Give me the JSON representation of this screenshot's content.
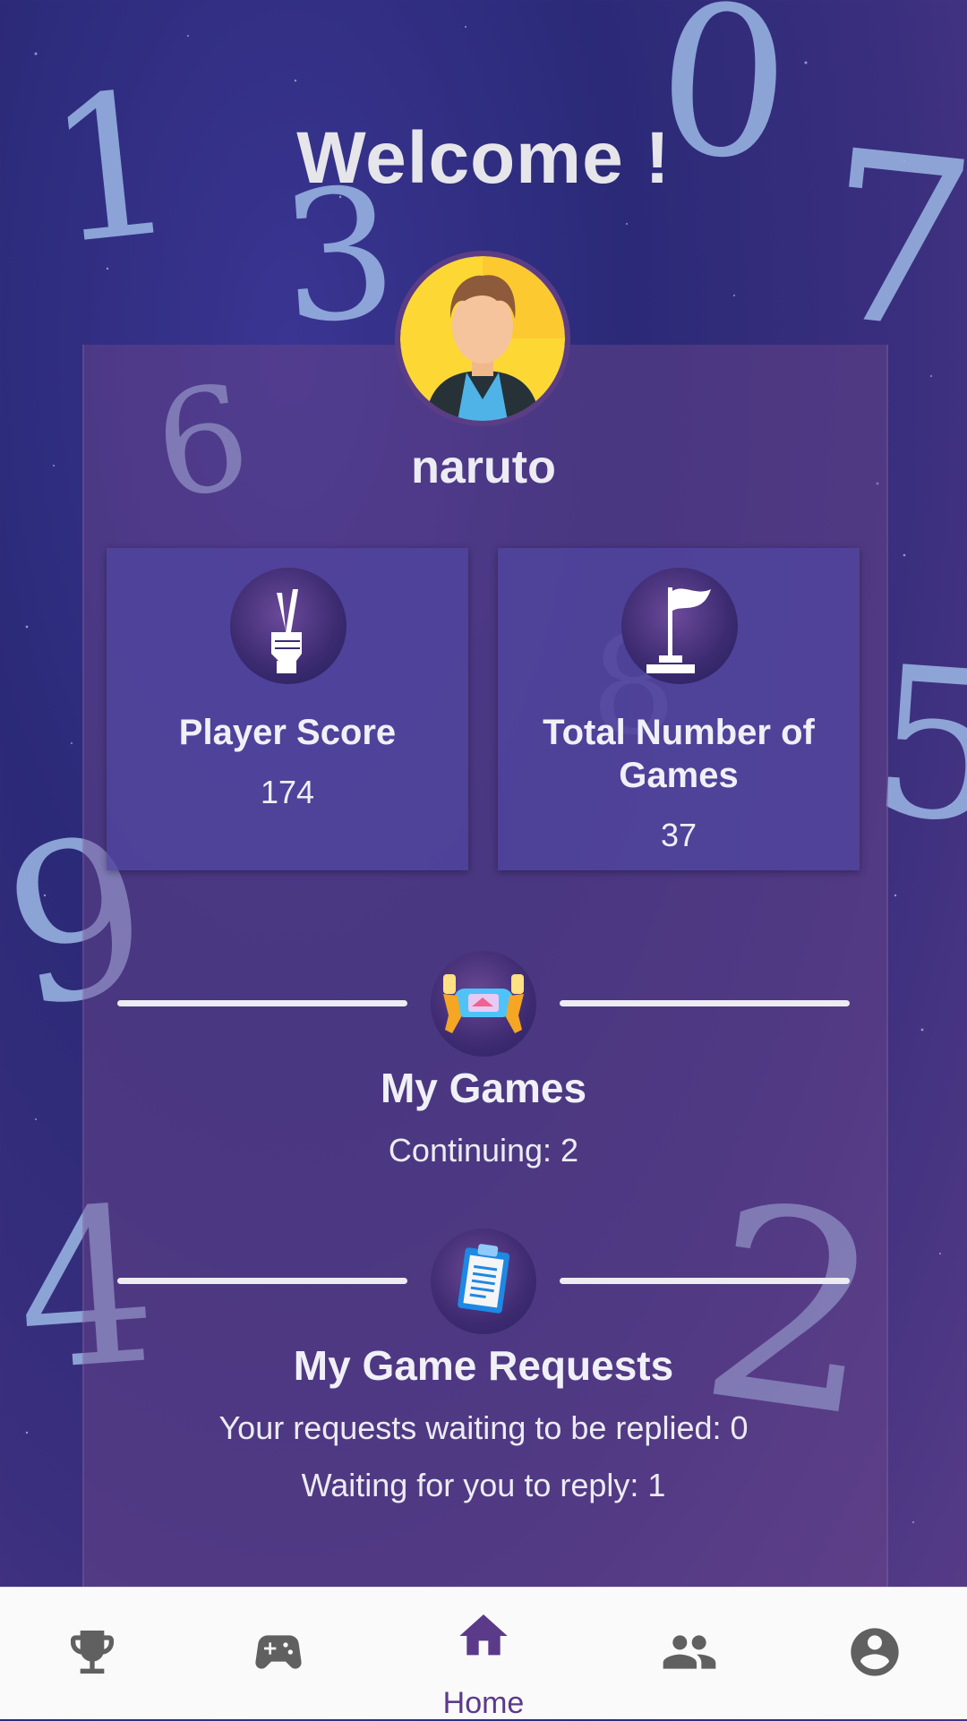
{
  "header": {
    "title": "Welcome !"
  },
  "profile": {
    "username": "naruto"
  },
  "stats": [
    {
      "title": "Player Score",
      "value": "174",
      "icon": "peace-hand-icon"
    },
    {
      "title": "Total Number of Games",
      "value": "37",
      "icon": "flag-icon"
    }
  ],
  "my_games": {
    "title": "My Games",
    "continuing": "Continuing: 2",
    "icon": "handheld-console-icon"
  },
  "requests": {
    "title": "My Game Requests",
    "waiting_replied": "Your requests waiting to be replied: 0",
    "waiting_you": "Waiting for you to reply: 1",
    "icon": "clipboard-icon"
  },
  "background_digits": [
    "1",
    "0",
    "7",
    "3",
    "6",
    "8",
    "5",
    "9",
    "4",
    "2"
  ],
  "nav": {
    "items": [
      {
        "icon": "trophy-icon",
        "label": ""
      },
      {
        "icon": "gamepad-icon",
        "label": ""
      },
      {
        "icon": "home-icon",
        "label": "Home",
        "active": true
      },
      {
        "icon": "friends-icon",
        "label": ""
      },
      {
        "icon": "account-icon",
        "label": ""
      }
    ]
  },
  "colors": {
    "accent": "#5b3a8a",
    "inactive_icon": "#606060",
    "background": "#2b2a78"
  }
}
